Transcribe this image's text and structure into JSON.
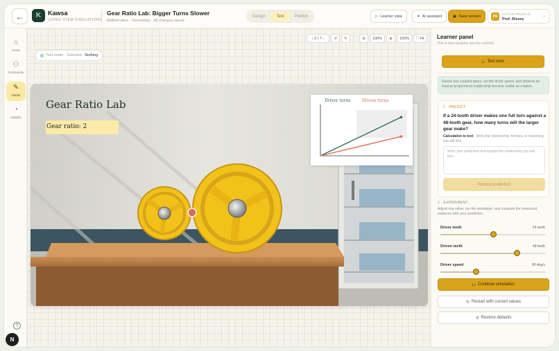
{
  "header": {
    "brand_name": "Kawsa",
    "brand_tagline": "LIVING STEM SIMULATIONS",
    "logo_letter": "K",
    "doc_title": "Gear Ratio Lab: Bigger Turns Slower",
    "doc_meta": "Mathematics · Secondary · All changes saved",
    "mode_tabs": [
      "Design",
      "Test",
      "Publish"
    ],
    "active_mode": "Test",
    "learner_view": "Learner view",
    "ai_assistant": "AI assistant",
    "save_version": "Save version",
    "profile_label": "ACTIVE PROFILE",
    "profile_name": "Prof. Rivera",
    "profile_initials": "PR"
  },
  "sidebar": {
    "items": [
      {
        "label": "Home",
        "icon": "home-icon",
        "glyph": "⌂"
      },
      {
        "label": "Community",
        "icon": "community-icon",
        "glyph": "⚇"
      },
      {
        "label": "Studio",
        "icon": "studio-icon",
        "glyph": "✎"
      },
      {
        "label": "Insights",
        "icon": "insights-icon",
        "glyph": "◔"
      }
    ],
    "active": "Studio",
    "help_glyph": "?",
    "badge": "N"
  },
  "canvas": {
    "page_indicator": "‹ 2 / 7 ›",
    "zoom_out_a": "100%",
    "zoom_in_a": "100%",
    "fit": "Fit",
    "mode_status": "Test mode · Selected:",
    "selected": "Nothing"
  },
  "scene": {
    "title": "Gear Ratio Lab",
    "ratio_text": "Gear ratio: 2",
    "legend_driver": "Driver turns",
    "legend_driven": "Driven turns",
    "colors": {
      "driver": "#2f6a55",
      "driven": "#e06a55",
      "gear": "#f2c21a"
    }
  },
  "chart_data": {
    "type": "line",
    "title": "",
    "xlabel": "",
    "ylabel": "",
    "series": [
      {
        "name": "Driver turns",
        "x": [
          0,
          1
        ],
        "values": [
          0,
          1
        ]
      },
      {
        "name": "Driven turns",
        "x": [
          0,
          1
        ],
        "values": [
          0,
          0.5
        ]
      }
    ],
    "xlim": [
      0,
      1.1
    ],
    "ylim": [
      0,
      1.4
    ],
    "grid": false,
    "legend": "top"
  },
  "panel": {
    "title": "Learner panel",
    "subtitle": "This is how students see the controls",
    "test_tutor": "Test tutor",
    "intro": "Resize two coupled gears, set the driver speed, and observe an inverse proportional relationship become visible as rotation.",
    "predict_label": "1 · PREDICT",
    "question": "If a 24-tooth driver makes one full turn against a 48-tooth gear, how many turns will the larger gear make?",
    "calc_label": "Calculation to test",
    "calc_hint": "Write the relationship, formula, or reasoning you will test.",
    "textarea_placeholder": "Write your prediction and explain the relationship you will test...",
    "record_btn": "Record prediction",
    "experiment_label": "2 · EXPERIMENT",
    "experiment_desc": "Adjust one value, run the simulation, and compare the measured evidence with your prediction.",
    "sliders": [
      {
        "label": "Driver teeth",
        "value": "24 teeth",
        "fraction": 0.5
      },
      {
        "label": "Driven teeth",
        "value": "48 teeth",
        "fraction": 0.73
      },
      {
        "label": "Driver speed",
        "value": "90 deg/s",
        "fraction": 0.34
      }
    ],
    "continue_btn": "Continue simulation",
    "restart_btn": "Restart with current values",
    "restore_btn": "Restore defaults"
  }
}
